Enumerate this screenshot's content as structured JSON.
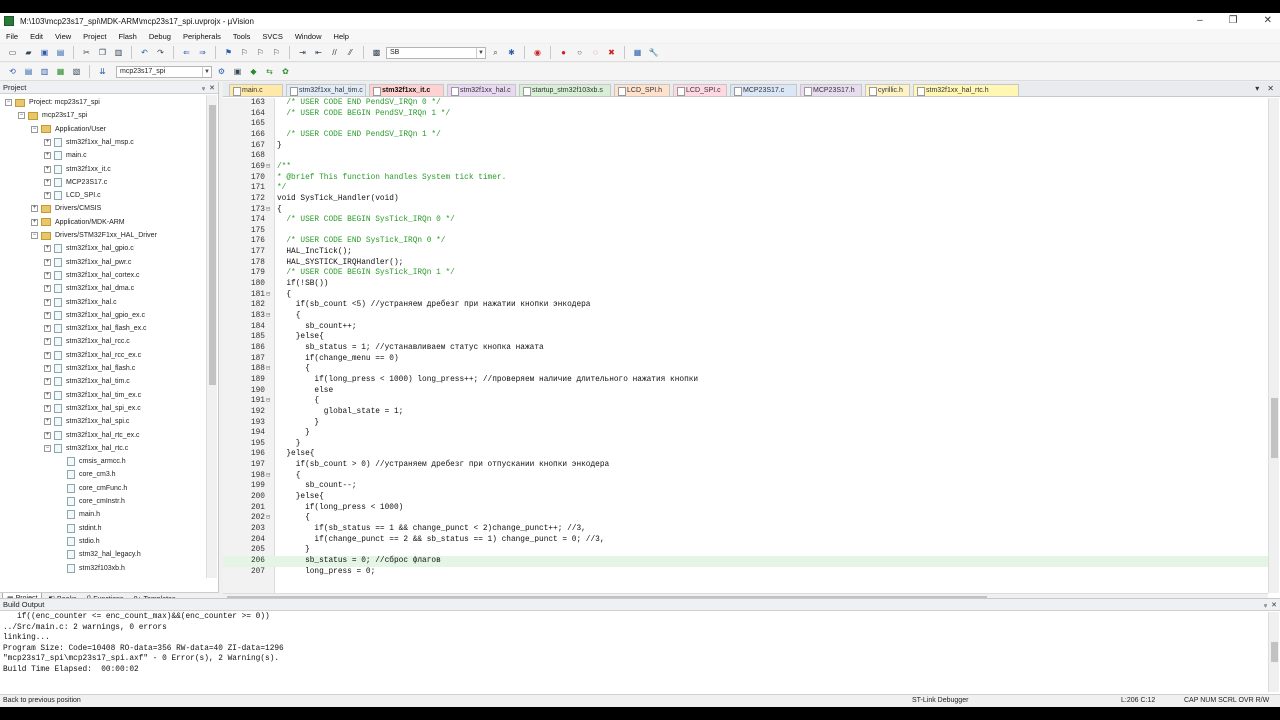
{
  "window": {
    "title": "M:\\103\\mcp23s17_spi\\MDK-ARM\\mcp23s17_spi.uvprojx - µVision",
    "controls": [
      "–",
      "❐",
      "✕"
    ]
  },
  "menu": [
    "File",
    "Edit",
    "View",
    "Project",
    "Flash",
    "Debug",
    "Peripherals",
    "Tools",
    "SVCS",
    "Window",
    "Help"
  ],
  "toolbar": {
    "search_value": "SB",
    "target_value": "mcp23s17_spi"
  },
  "project_panel": {
    "title": "Project",
    "controls": [
      "ᵩ",
      "✕"
    ],
    "tree": [
      {
        "label": "Project: mcp23s17_spi",
        "level": 0,
        "exp": "−",
        "kind": "project"
      },
      {
        "label": "mcp23s17_spi",
        "level": 1,
        "exp": "−",
        "kind": "folder"
      },
      {
        "label": "Application/User",
        "level": 2,
        "exp": "−",
        "kind": "folder"
      },
      {
        "label": "stm32f1xx_hal_msp.c",
        "level": 3,
        "exp": "+",
        "kind": "file"
      },
      {
        "label": "main.c",
        "level": 3,
        "exp": "+",
        "kind": "file"
      },
      {
        "label": "stm32f1xx_it.c",
        "level": 3,
        "exp": "+",
        "kind": "file"
      },
      {
        "label": "MCP23S17.c",
        "level": 3,
        "exp": "+",
        "kind": "file"
      },
      {
        "label": "LCD_SPI.c",
        "level": 3,
        "exp": "+",
        "kind": "file"
      },
      {
        "label": "Drivers/CMSIS",
        "level": 2,
        "exp": "+",
        "kind": "folder"
      },
      {
        "label": "Application/MDK-ARM",
        "level": 2,
        "exp": "+",
        "kind": "folder"
      },
      {
        "label": "Drivers/STM32F1xx_HAL_Driver",
        "level": 2,
        "exp": "−",
        "kind": "folder"
      },
      {
        "label": "stm32f1xx_hal_gpio.c",
        "level": 3,
        "exp": "+",
        "kind": "file"
      },
      {
        "label": "stm32f1xx_hal_pwr.c",
        "level": 3,
        "exp": "+",
        "kind": "file"
      },
      {
        "label": "stm32f1xx_hal_cortex.c",
        "level": 3,
        "exp": "+",
        "kind": "file"
      },
      {
        "label": "stm32f1xx_hal_dma.c",
        "level": 3,
        "exp": "+",
        "kind": "file"
      },
      {
        "label": "stm32f1xx_hal.c",
        "level": 3,
        "exp": "+",
        "kind": "file"
      },
      {
        "label": "stm32f1xx_hal_gpio_ex.c",
        "level": 3,
        "exp": "+",
        "kind": "file"
      },
      {
        "label": "stm32f1xx_hal_flash_ex.c",
        "level": 3,
        "exp": "+",
        "kind": "file"
      },
      {
        "label": "stm32f1xx_hal_rcc.c",
        "level": 3,
        "exp": "+",
        "kind": "file"
      },
      {
        "label": "stm32f1xx_hal_rcc_ex.c",
        "level": 3,
        "exp": "+",
        "kind": "file"
      },
      {
        "label": "stm32f1xx_hal_flash.c",
        "level": 3,
        "exp": "+",
        "kind": "file"
      },
      {
        "label": "stm32f1xx_hal_tim.c",
        "level": 3,
        "exp": "+",
        "kind": "file"
      },
      {
        "label": "stm32f1xx_hal_tim_ex.c",
        "level": 3,
        "exp": "+",
        "kind": "file"
      },
      {
        "label": "stm32f1xx_hal_spi_ex.c",
        "level": 3,
        "exp": "+",
        "kind": "file"
      },
      {
        "label": "stm32f1xx_hal_spi.c",
        "level": 3,
        "exp": "+",
        "kind": "file"
      },
      {
        "label": "stm32f1xx_hal_rtc_ex.c",
        "level": 3,
        "exp": "+",
        "kind": "file"
      },
      {
        "label": "stm32f1xx_hal_rtc.c",
        "level": 3,
        "exp": "−",
        "kind": "file"
      },
      {
        "label": "cmsis_armcc.h",
        "level": 4,
        "exp": "",
        "kind": "file"
      },
      {
        "label": "core_cm3.h",
        "level": 4,
        "exp": "",
        "kind": "file"
      },
      {
        "label": "core_cmFunc.h",
        "level": 4,
        "exp": "",
        "kind": "file"
      },
      {
        "label": "core_cmInstr.h",
        "level": 4,
        "exp": "",
        "kind": "file"
      },
      {
        "label": "main.h",
        "level": 4,
        "exp": "",
        "kind": "file"
      },
      {
        "label": "stdint.h",
        "level": 4,
        "exp": "",
        "kind": "file"
      },
      {
        "label": "stdio.h",
        "level": 4,
        "exp": "",
        "kind": "file"
      },
      {
        "label": "stm32_hal_legacy.h",
        "level": 4,
        "exp": "",
        "kind": "file"
      },
      {
        "label": "stm32f103xb.h",
        "level": 4,
        "exp": "",
        "kind": "file"
      }
    ],
    "bottom_tabs": [
      {
        "label": "Project",
        "icon": "▦",
        "active": true
      },
      {
        "label": "Books",
        "icon": "◧",
        "active": false
      },
      {
        "label": "Functions",
        "icon": "{}",
        "active": false
      },
      {
        "label": "Templates",
        "icon": "0+",
        "active": false
      }
    ]
  },
  "editor": {
    "tabs": [
      {
        "label": "main.c",
        "color": "#ffe9a8",
        "active": false
      },
      {
        "label": "stm32f1xx_hal_tim.c",
        "color": "#e2ecf7",
        "active": false
      },
      {
        "label": "stm32f1xx_it.c",
        "color": "#ffd1d1",
        "active": true
      },
      {
        "label": "stm32f1xx_hal.c",
        "color": "#e8d8f2",
        "active": false
      },
      {
        "label": "startup_stm32f103xb.s",
        "color": "#d8efd6",
        "active": false
      },
      {
        "label": "LCD_SPI.h",
        "color": "#ffe1cc",
        "active": false
      },
      {
        "label": "LCD_SPI.c",
        "color": "#ffd8e4",
        "active": false
      },
      {
        "label": "MCP23S17.c",
        "color": "#dbe6f7",
        "active": false
      },
      {
        "label": "MCP23S17.h",
        "color": "#e8dcef",
        "active": false
      },
      {
        "label": "cyrillic.h",
        "color": "#fff3c4",
        "active": false
      },
      {
        "label": "stm32f1xx_hal_rtc.h",
        "color": "#fff7b3",
        "active": false
      }
    ],
    "tab_controls": [
      "▾",
      "✕"
    ],
    "lines": [
      {
        "n": "163",
        "f": "",
        "t": "  /* USER CODE END PendSV_IRQn 0 */",
        "c": "cm"
      },
      {
        "n": "164",
        "f": "",
        "t": "  /* USER CODE BEGIN PendSV_IRQn 1 */",
        "c": "cm"
      },
      {
        "n": "165",
        "f": "",
        "t": "",
        "c": ""
      },
      {
        "n": "166",
        "f": "",
        "t": "  /* USER CODE END PendSV_IRQn 1 */",
        "c": "cm"
      },
      {
        "n": "167",
        "f": "",
        "t": "}",
        "c": ""
      },
      {
        "n": "168",
        "f": "",
        "t": "",
        "c": ""
      },
      {
        "n": "169",
        "f": "⊟",
        "t": "/**",
        "c": "cm"
      },
      {
        "n": "170",
        "f": "",
        "t": "* @brief This function handles System tick timer.",
        "c": "cm"
      },
      {
        "n": "171",
        "f": "",
        "t": "*/",
        "c": "cm"
      },
      {
        "n": "172",
        "f": "",
        "t": "void SysTick_Handler(void)",
        "c": ""
      },
      {
        "n": "173",
        "f": "⊟",
        "t": "{",
        "c": ""
      },
      {
        "n": "174",
        "f": "",
        "t": "  /* USER CODE BEGIN SysTick_IRQn 0 */",
        "c": "cm"
      },
      {
        "n": "175",
        "f": "",
        "t": "",
        "c": ""
      },
      {
        "n": "176",
        "f": "",
        "t": "  /* USER CODE END SysTick_IRQn 0 */",
        "c": "cm"
      },
      {
        "n": "177",
        "f": "",
        "t": "  HAL_IncTick();",
        "c": ""
      },
      {
        "n": "178",
        "f": "",
        "t": "  HAL_SYSTICK_IRQHandler();",
        "c": ""
      },
      {
        "n": "179",
        "f": "",
        "t": "  /* USER CODE BEGIN SysTick_IRQn 1 */",
        "c": "cm"
      },
      {
        "n": "180",
        "f": "",
        "t": "  if(!SB())",
        "c": ""
      },
      {
        "n": "181",
        "f": "⊟",
        "t": "  {",
        "c": ""
      },
      {
        "n": "182",
        "f": "",
        "t": "    if(sb_count <5) //устраняем дребезг при нажатии кнопки энкодера",
        "c": ""
      },
      {
        "n": "183",
        "f": "⊟",
        "t": "    {",
        "c": ""
      },
      {
        "n": "184",
        "f": "",
        "t": "      sb_count++;",
        "c": ""
      },
      {
        "n": "185",
        "f": "",
        "t": "    }else{",
        "c": ""
      },
      {
        "n": "186",
        "f": "",
        "t": "      sb_status = 1; //устанавливаем статус кнопка нажата",
        "c": ""
      },
      {
        "n": "187",
        "f": "",
        "t": "      if(change_menu == 0)",
        "c": ""
      },
      {
        "n": "188",
        "f": "⊟",
        "t": "      {",
        "c": ""
      },
      {
        "n": "189",
        "f": "",
        "t": "        if(long_press < 1000) long_press++; //проверяем наличие длительного нажатия кнопки",
        "c": ""
      },
      {
        "n": "190",
        "f": "",
        "t": "        else",
        "c": ""
      },
      {
        "n": "191",
        "f": "⊟",
        "t": "        {",
        "c": ""
      },
      {
        "n": "192",
        "f": "",
        "t": "          global_state = 1;",
        "c": ""
      },
      {
        "n": "193",
        "f": "",
        "t": "        }",
        "c": ""
      },
      {
        "n": "194",
        "f": "",
        "t": "      }",
        "c": ""
      },
      {
        "n": "195",
        "f": "",
        "t": "    }",
        "c": ""
      },
      {
        "n": "196",
        "f": "",
        "t": "  }else{",
        "c": ""
      },
      {
        "n": "197",
        "f": "",
        "t": "    if(sb_count > 0) //устраняем дребезг при отпускании кнопки энкодера",
        "c": ""
      },
      {
        "n": "198",
        "f": "⊟",
        "t": "    {",
        "c": ""
      },
      {
        "n": "199",
        "f": "",
        "t": "      sb_count--;",
        "c": ""
      },
      {
        "n": "200",
        "f": "",
        "t": "    }else{",
        "c": ""
      },
      {
        "n": "201",
        "f": "",
        "t": "      if(long_press < 1000)",
        "c": ""
      },
      {
        "n": "202",
        "f": "⊟",
        "t": "      {",
        "c": ""
      },
      {
        "n": "203",
        "f": "",
        "t": "        if(sb_status == 1 && change_punct < 2)change_punct++; //3,",
        "c": ""
      },
      {
        "n": "204",
        "f": "",
        "t": "        if(change_punct == 2 && sb_status == 1) change_punct = 0; //3,",
        "c": ""
      },
      {
        "n": "205",
        "f": "",
        "t": "      }",
        "c": ""
      },
      {
        "n": "206",
        "f": "",
        "t": "      sb_status = 0; //сброс флагов",
        "c": "",
        "hl": true
      },
      {
        "n": "207",
        "f": "",
        "t": "      long_press = 0;",
        "c": ""
      }
    ]
  },
  "build_output": {
    "title": "Build Output",
    "controls": [
      "ᵩ",
      "✕"
    ],
    "lines": [
      "   if((enc_counter <= enc_count_max)&&(enc_counter >= 0))",
      "../Src/main.c: 2 warnings, 0 errors",
      "linking...",
      "Program Size: Code=10408 RO-data=356 RW-data=40 ZI-data=1296",
      "\"mcp23s17_spi\\mcp23s17_spi.axf\" - 0 Error(s), 2 Warning(s).",
      "Build Time Elapsed:  00:00:02"
    ]
  },
  "status_bar": {
    "message": "Back to previous position",
    "debugger": "ST-Link Debugger",
    "position": "L:206 C:12",
    "indicators": "CAP  NUM  SCRL  OVR  R/W"
  }
}
